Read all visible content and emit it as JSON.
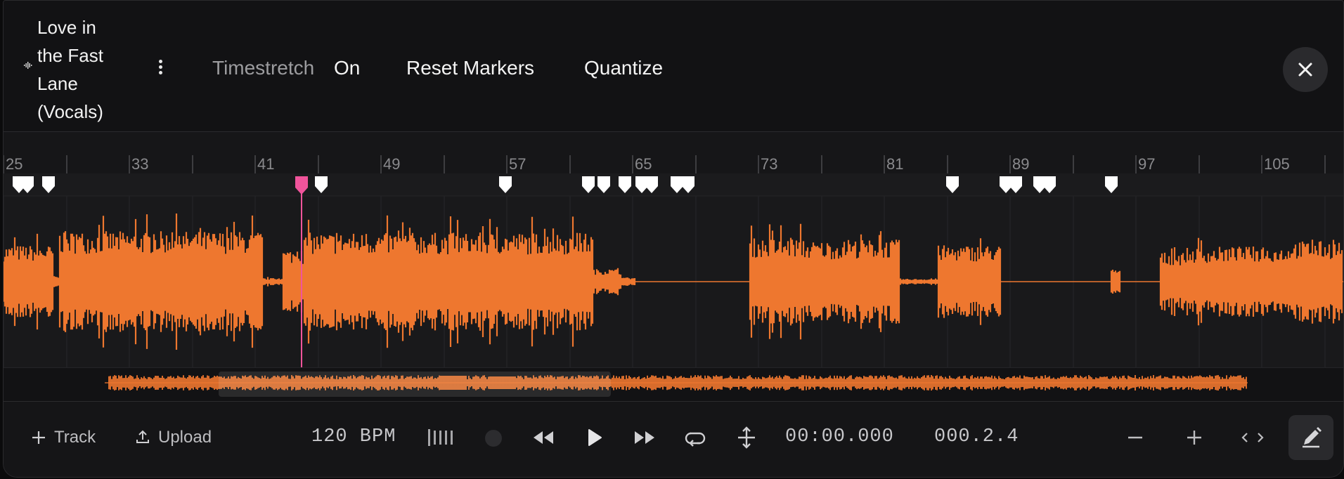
{
  "header": {
    "track_title_lines": [
      "Love in",
      "the Fast",
      "Lane",
      "(Vocals)"
    ],
    "timestretch_label": "Timestretch",
    "timestretch_value": "On",
    "reset_markers_label": "Reset Markers",
    "quantize_label": "Quantize"
  },
  "ruler": {
    "bar_labels": [
      "25",
      "33",
      "41",
      "49",
      "57",
      "65",
      "73",
      "81",
      "89",
      "97",
      "105"
    ]
  },
  "footer": {
    "track_label": "Track",
    "upload_label": "Upload",
    "bpm": "120 BPM",
    "time": "00:00.000",
    "position": "000.2.4"
  },
  "colors": {
    "waveform": "#ee772f",
    "playhead": "#f0549b",
    "marker": "#ffffff"
  },
  "icons": [
    "waveform-icon",
    "more-vertical-icon",
    "close-icon",
    "plus-icon",
    "upload-icon",
    "metronome-icon",
    "record-icon",
    "rewind-icon",
    "play-icon",
    "fast-forward-icon",
    "loop-icon",
    "split-icon",
    "zoom-out-icon",
    "zoom-in-icon",
    "code-brackets-icon",
    "edit-pen-icon"
  ]
}
